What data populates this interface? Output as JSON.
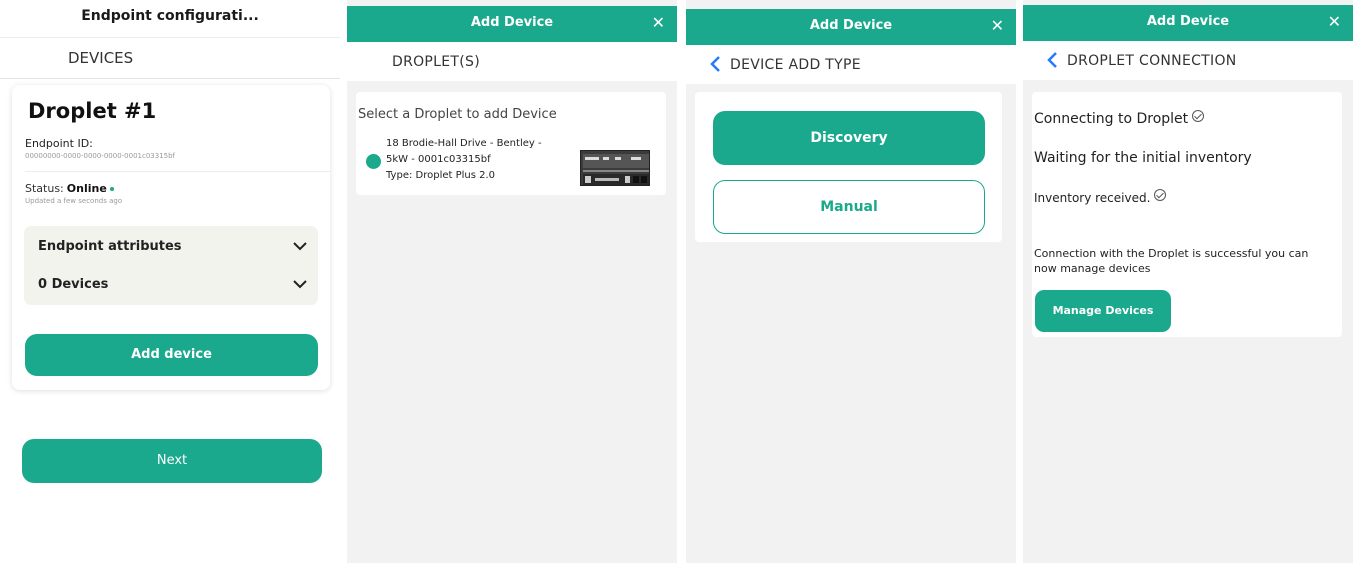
{
  "colors": {
    "accent": "#1aa98d",
    "background": "#f2f2f2",
    "back_arrow": "#2979ff"
  },
  "panel1": {
    "window_title": "Endpoint configurati...",
    "section_heading": "DEVICES",
    "card": {
      "title": "Droplet #1",
      "endpoint_id_label": "Endpoint ID:",
      "endpoint_id_value": "00000000-0000-0000-0000-0001c03315bf",
      "status_label": "Status:",
      "status_value": "Online",
      "updated_text": "Updated a few seconds ago",
      "accordion": [
        {
          "label": "Endpoint attributes",
          "icon": "chevron-down-icon"
        },
        {
          "label": "0 Devices",
          "icon": "chevron-down-icon"
        }
      ],
      "add_device_label": "Add device"
    },
    "next_label": "Next"
  },
  "panel2": {
    "header_title": "Add Device",
    "close_icon": "✕",
    "subheading": "DROPLET(S)",
    "prompt": "Select a Droplet to add Device",
    "droplet": {
      "line1": "18 Brodie-Hall Drive - Bentley -",
      "line2": "5kW - 0001c03315bf",
      "line3": "Type: Droplet Plus 2.0"
    }
  },
  "panel3": {
    "header_title": "Add Device",
    "close_icon": "✕",
    "subheading": "DEVICE ADD TYPE",
    "discovery_label": "Discovery",
    "manual_label": "Manual"
  },
  "panel4": {
    "header_title": "Add Device",
    "close_icon": "✕",
    "subheading": "DROPLET CONNECTION",
    "connecting_text": "Connecting to Droplet",
    "waiting_text": "Waiting for the initial inventory",
    "inventory_text": "Inventory received.",
    "success_text": "Connection with the Droplet is successful you can now manage devices",
    "manage_label": "Manage Devices"
  }
}
